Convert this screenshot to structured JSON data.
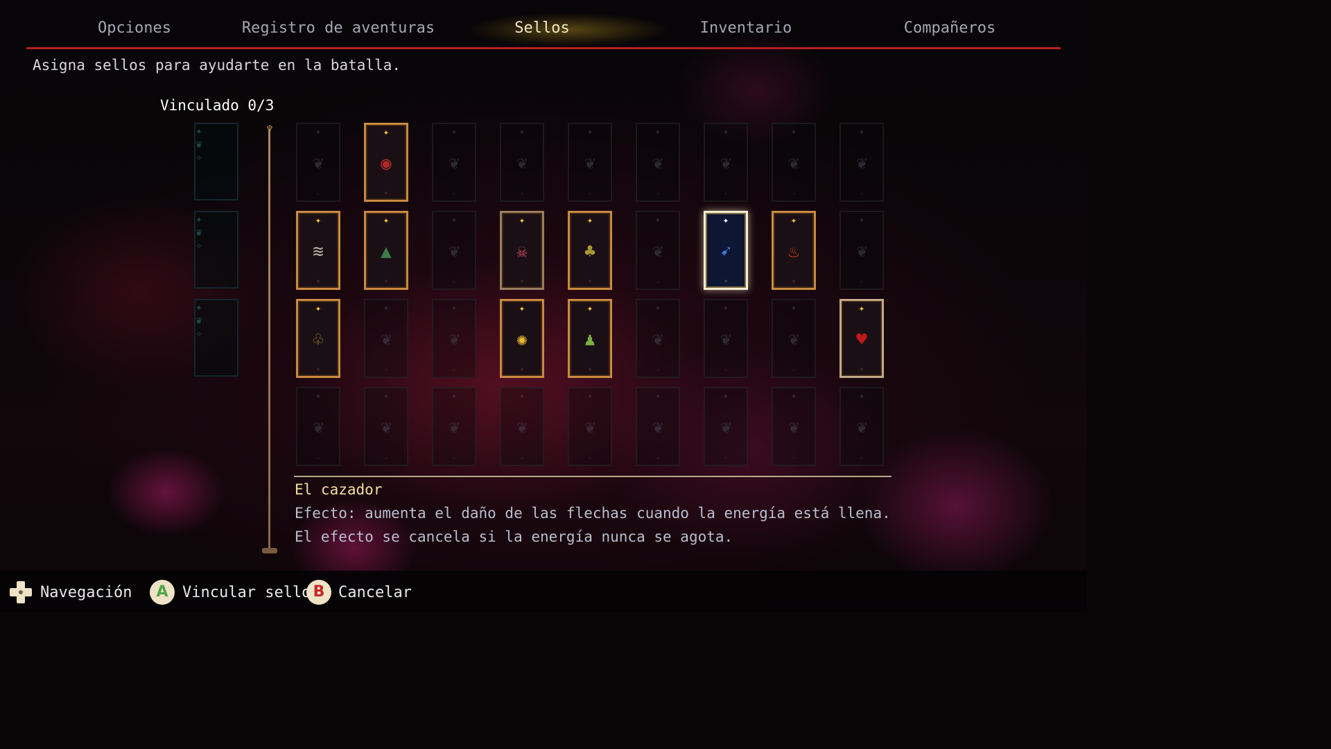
{
  "tabs": [
    {
      "label": "Opciones"
    },
    {
      "label": "Registro de aventuras"
    },
    {
      "label": "Sellos"
    },
    {
      "label": "Inventario"
    },
    {
      "label": "Compañeros"
    }
  ],
  "active_tab": "Sellos",
  "subtitle": "Asigna sellos para ayudarte en la batalla.",
  "linked_label": "Vinculado 0/3",
  "colors": {
    "accent_red": "#b81e22",
    "card_gold": "#c98a40",
    "selected_title": "#f4df9e",
    "empty_teal": "#1e4a4c"
  },
  "seal_grid": {
    "rows": 4,
    "cols": 9,
    "owned": [
      {
        "row": 0,
        "col": 1,
        "icon": "eye-seal-icon",
        "color": "#b02a2a"
      },
      {
        "row": 1,
        "col": 0,
        "icon": "claw-seal-icon",
        "color": "#b8b0a0"
      },
      {
        "row": 1,
        "col": 1,
        "icon": "wizard-seal-icon",
        "color": "#3c7c4a"
      },
      {
        "row": 1,
        "col": 3,
        "icon": "skull-seal-icon",
        "color": "#c04a5a"
      },
      {
        "row": 1,
        "col": 4,
        "icon": "sprout-seal-icon",
        "color": "#a89a30"
      },
      {
        "row": 1,
        "col": 6,
        "icon": "arrow-seal-icon",
        "color": "#3a7ae0"
      },
      {
        "row": 1,
        "col": 7,
        "icon": "phoenix-seal-icon",
        "color": "#e04a22"
      },
      {
        "row": 2,
        "col": 0,
        "icon": "clover-seal-icon",
        "color": "#9a8a30"
      },
      {
        "row": 2,
        "col": 3,
        "icon": "burst-seal-icon",
        "color": "#e8b830"
      },
      {
        "row": 2,
        "col": 4,
        "icon": "sprite-seal-icon",
        "color": "#7ab040"
      },
      {
        "row": 2,
        "col": 8,
        "icon": "blood-seal-icon",
        "color": "#c01818"
      }
    ],
    "selected": {
      "row": 1,
      "col": 6
    }
  },
  "bound_slots": 3,
  "description": {
    "title": "El cazador",
    "line1": "Efecto: aumenta el daño de las flechas cuando la energía está llena.",
    "line2": "El efecto se cancela si la energía nunca se agota."
  },
  "controls": [
    {
      "icon": "dpad-icon",
      "label": "Navegación"
    },
    {
      "icon": "a-button-icon",
      "button": "A",
      "label": "Vincular sello",
      "color": "#4fa64a"
    },
    {
      "icon": "b-button-icon",
      "button": "B",
      "label": "Cancelar",
      "color": "#c0282a"
    }
  ]
}
